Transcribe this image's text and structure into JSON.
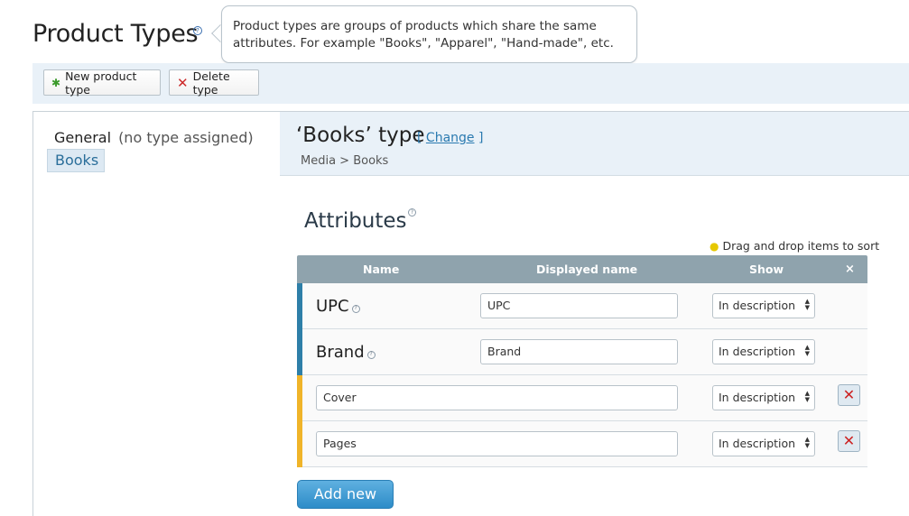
{
  "page": {
    "title": "Product Types",
    "help_glyph": "?"
  },
  "tooltip": {
    "text": "Product types are groups of products which share the same attributes. For example \"Books\", \"Apparel\", \"Hand-made\", etc."
  },
  "toolbar": {
    "new_label": "New product type",
    "new_icon": "✱",
    "delete_label": "Delete type",
    "delete_icon": "✕"
  },
  "sidebar": {
    "general_label": "General",
    "general_note": "(no type assigned)",
    "selected_label": "Books"
  },
  "type_header": {
    "title": "‘Books’ type",
    "change_open": "[ ",
    "change_label": "Change",
    "change_close": " ]",
    "breadcrumb": "Media > Books"
  },
  "attributes": {
    "title": "Attributes",
    "sort_hint": "Drag and drop items to sort",
    "columns": {
      "name": "Name",
      "displayed": "Displayed name",
      "show": "Show",
      "remove": "×"
    },
    "rows": [
      {
        "name": "UPC",
        "displayed": "UPC",
        "show": "In description"
      },
      {
        "name": "Brand",
        "displayed": "Brand",
        "show": "In description"
      },
      {
        "name": "",
        "displayed": "Cover",
        "show": "In description"
      },
      {
        "name": "",
        "displayed": "Pages",
        "show": "In description"
      }
    ],
    "add_label": "Add new"
  },
  "colors": {
    "accent_blue": "#2e7fa8",
    "custom_yellow": "#f0b429",
    "header_gray": "#8fa3ad",
    "toolbar_bg": "#e9f1f8"
  }
}
